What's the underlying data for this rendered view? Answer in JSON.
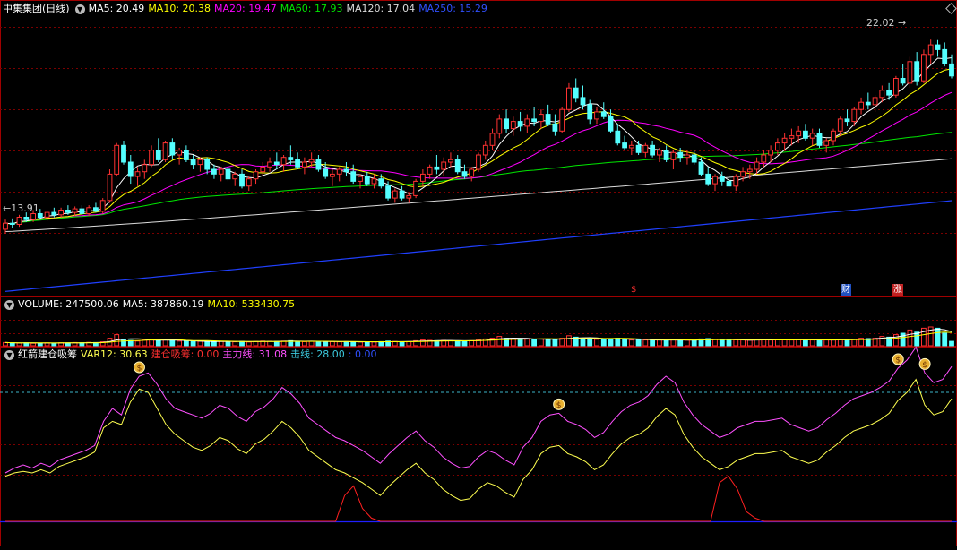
{
  "colors": {
    "up": "#ff3232",
    "down": "#54ffff",
    "ma5": "#ffffff",
    "ma10": "#ffff00",
    "ma20": "#ff00ff",
    "ma60": "#00e600",
    "ma120": "#dcdcdc",
    "ma250": "#2040ff",
    "grid": "#7a0000",
    "panel_border": "#a00000",
    "dashed_level": "#3cb4c8",
    "main_line": "#ff50ff",
    "var12_line": "#ffff50",
    "build_line": "#ff2020",
    "strike_line": "#2020ff"
  },
  "price_panel": {
    "title": "中集集团(日线)",
    "ma_labels": [
      {
        "text": "MA5: 20.49",
        "color": "#ffffff"
      },
      {
        "text": "MA10: 20.38",
        "color": "#ffff00"
      },
      {
        "text": "MA20: 19.47",
        "color": "#ff00ff"
      },
      {
        "text": "MA60: 17.93",
        "color": "#00e600"
      },
      {
        "text": "MA120: 17.04",
        "color": "#dcdcdc"
      },
      {
        "text": "MA250: 15.29",
        "color": "#3050ff"
      }
    ],
    "high_label": "22.02",
    "low_label": "13.91",
    "event_flags": [
      {
        "text": "$",
        "color": "#ff3030",
        "bg": "transparent"
      },
      {
        "text": "财",
        "color": "#ffffff",
        "bg": "#2050c0"
      },
      {
        "text": "涨",
        "color": "#ffffff",
        "bg": "#c02020"
      }
    ]
  },
  "volume_panel": {
    "labels": [
      {
        "text": "VOLUME: 247500.06",
        "color": "#ffffff"
      },
      {
        "text": "MA5: 387860.19",
        "color": "#ffffff"
      },
      {
        "text": "MA10: 533430.75",
        "color": "#ffff00"
      }
    ]
  },
  "indicator_panel": {
    "labels": [
      {
        "text": "红箭建仓吸筹",
        "color": "#ffffff"
      },
      {
        "text": "VAR12: 30.63",
        "color": "#ffff50"
      },
      {
        "text": "建仓吸筹: 0.00",
        "color": "#ff3030"
      },
      {
        "text": "主力线: 31.08",
        "color": "#ff50ff"
      },
      {
        "text": "击线: 28.00",
        "color": "#3cc8dc"
      },
      {
        "text": ": 0.00",
        "color": "#3050ff"
      }
    ],
    "money_icon_glyph": "$"
  },
  "chart_data": {
    "type": "candlestick",
    "title": "中集集团(日线)",
    "price_range": [
      11.4,
      23.0
    ],
    "candles_ohlc": [
      [
        14.1,
        14.5,
        13.91,
        14.35
      ],
      [
        14.35,
        14.55,
        14.15,
        14.3
      ],
      [
        14.3,
        14.7,
        14.2,
        14.6
      ],
      [
        14.6,
        14.8,
        14.4,
        14.5
      ],
      [
        14.5,
        14.9,
        14.4,
        14.75
      ],
      [
        14.75,
        14.95,
        14.55,
        14.6
      ],
      [
        14.6,
        14.85,
        14.45,
        14.8
      ],
      [
        14.8,
        15.0,
        14.6,
        14.7
      ],
      [
        14.7,
        15.0,
        14.6,
        14.9
      ],
      [
        14.9,
        15.1,
        14.7,
        14.8
      ],
      [
        14.8,
        15.05,
        14.65,
        14.95
      ],
      [
        14.95,
        15.1,
        14.7,
        14.75
      ],
      [
        14.75,
        15.1,
        14.65,
        15.0
      ],
      [
        15.0,
        15.2,
        14.8,
        14.85
      ],
      [
        14.85,
        15.4,
        14.75,
        15.3
      ],
      [
        15.3,
        16.6,
        15.2,
        16.4
      ],
      [
        16.4,
        17.7,
        16.3,
        17.6
      ],
      [
        17.6,
        17.8,
        16.8,
        16.9
      ],
      [
        16.9,
        17.2,
        16.0,
        16.3
      ],
      [
        16.3,
        16.7,
        15.9,
        16.5
      ],
      [
        16.5,
        17.0,
        16.2,
        16.8
      ],
      [
        16.8,
        17.6,
        16.7,
        17.4
      ],
      [
        17.4,
        17.9,
        16.9,
        17.0
      ],
      [
        17.0,
        17.8,
        16.9,
        17.7
      ],
      [
        17.7,
        17.9,
        17.0,
        17.2
      ],
      [
        17.2,
        17.5,
        16.8,
        17.4
      ],
      [
        17.4,
        17.6,
        16.9,
        17.0
      ],
      [
        17.0,
        17.2,
        16.6,
        16.8
      ],
      [
        16.8,
        17.1,
        16.5,
        17.0
      ],
      [
        17.0,
        17.1,
        16.4,
        16.6
      ],
      [
        16.6,
        16.8,
        16.2,
        16.4
      ],
      [
        16.4,
        16.7,
        16.1,
        16.6
      ],
      [
        16.6,
        16.8,
        16.1,
        16.2
      ],
      [
        16.2,
        16.5,
        15.9,
        16.4
      ],
      [
        16.4,
        16.6,
        15.8,
        15.9
      ],
      [
        15.9,
        16.3,
        15.7,
        16.2
      ],
      [
        16.2,
        16.6,
        16.0,
        16.5
      ],
      [
        16.5,
        16.9,
        16.3,
        16.7
      ],
      [
        16.7,
        17.1,
        16.5,
        16.9
      ],
      [
        16.9,
        17.3,
        16.6,
        16.8
      ],
      [
        16.8,
        17.2,
        16.5,
        17.1
      ],
      [
        17.1,
        17.6,
        16.8,
        17.0
      ],
      [
        17.0,
        17.3,
        16.6,
        16.7
      ],
      [
        16.7,
        17.1,
        16.4,
        16.9
      ],
      [
        16.9,
        17.3,
        16.7,
        17.0
      ],
      [
        17.0,
        17.2,
        16.5,
        16.6
      ],
      [
        16.6,
        16.9,
        16.2,
        16.3
      ],
      [
        16.3,
        16.6,
        15.9,
        16.4
      ],
      [
        16.4,
        16.7,
        16.1,
        16.6
      ],
      [
        16.6,
        16.9,
        16.3,
        16.5
      ],
      [
        16.5,
        16.8,
        16.0,
        16.1
      ],
      [
        16.1,
        16.4,
        15.8,
        16.3
      ],
      [
        16.3,
        16.5,
        15.9,
        16.0
      ],
      [
        16.0,
        16.4,
        15.8,
        16.2
      ],
      [
        16.2,
        16.4,
        15.8,
        15.9
      ],
      [
        15.9,
        16.1,
        15.3,
        15.4
      ],
      [
        15.4,
        15.8,
        15.2,
        15.7
      ],
      [
        15.7,
        15.9,
        15.3,
        15.4
      ],
      [
        15.4,
        15.6,
        15.2,
        15.5
      ],
      [
        15.5,
        16.2,
        15.4,
        16.1
      ],
      [
        16.1,
        16.6,
        15.9,
        16.4
      ],
      [
        16.4,
        16.8,
        16.2,
        16.7
      ],
      [
        16.7,
        17.2,
        16.4,
        16.6
      ],
      [
        16.6,
        17.1,
        16.3,
        16.9
      ],
      [
        16.9,
        17.3,
        16.7,
        17.0
      ],
      [
        17.0,
        17.2,
        16.4,
        16.5
      ],
      [
        16.5,
        16.8,
        16.2,
        16.3
      ],
      [
        16.3,
        16.7,
        16.1,
        16.6
      ],
      [
        16.6,
        17.3,
        16.5,
        17.2
      ],
      [
        17.2,
        17.8,
        17.0,
        17.6
      ],
      [
        17.6,
        18.3,
        17.4,
        18.1
      ],
      [
        18.1,
        18.9,
        17.9,
        18.7
      ],
      [
        18.7,
        19.1,
        18.1,
        18.3
      ],
      [
        18.3,
        18.8,
        18.0,
        18.6
      ],
      [
        18.6,
        19.0,
        18.2,
        18.4
      ],
      [
        18.4,
        18.9,
        18.1,
        18.7
      ],
      [
        18.7,
        19.2,
        18.4,
        18.6
      ],
      [
        18.6,
        19.1,
        18.3,
        18.9
      ],
      [
        18.9,
        19.3,
        18.4,
        18.5
      ],
      [
        18.5,
        18.9,
        18.0,
        18.2
      ],
      [
        18.2,
        19.2,
        18.1,
        19.1
      ],
      [
        19.1,
        20.2,
        19.0,
        20.0
      ],
      [
        20.0,
        20.4,
        19.4,
        19.6
      ],
      [
        19.6,
        20.1,
        19.1,
        19.3
      ],
      [
        19.3,
        19.5,
        18.5,
        18.7
      ],
      [
        18.7,
        19.2,
        18.5,
        19.0
      ],
      [
        19.0,
        19.4,
        18.7,
        18.8
      ],
      [
        18.8,
        19.1,
        18.1,
        18.2
      ],
      [
        18.2,
        18.5,
        17.6,
        17.7
      ],
      [
        17.7,
        18.0,
        17.4,
        17.5
      ],
      [
        17.5,
        17.8,
        17.2,
        17.6
      ],
      [
        17.6,
        17.8,
        17.2,
        17.3
      ],
      [
        17.3,
        17.7,
        17.1,
        17.6
      ],
      [
        17.6,
        17.8,
        17.1,
        17.2
      ],
      [
        17.2,
        17.5,
        16.9,
        17.4
      ],
      [
        17.4,
        17.6,
        16.9,
        17.0
      ],
      [
        17.0,
        17.4,
        16.6,
        17.3
      ],
      [
        17.3,
        17.5,
        16.9,
        17.1
      ],
      [
        17.1,
        17.4,
        16.8,
        17.2
      ],
      [
        17.2,
        17.4,
        16.8,
        16.9
      ],
      [
        16.9,
        17.1,
        16.3,
        16.4
      ],
      [
        16.4,
        16.7,
        15.9,
        16.0
      ],
      [
        16.0,
        16.4,
        15.7,
        16.3
      ],
      [
        16.3,
        16.5,
        15.9,
        16.1
      ],
      [
        16.1,
        16.4,
        15.8,
        15.9
      ],
      [
        15.9,
        16.4,
        15.7,
        16.3
      ],
      [
        16.3,
        16.7,
        16.1,
        16.5
      ],
      [
        16.5,
        16.8,
        16.2,
        16.6
      ],
      [
        16.6,
        17.1,
        16.4,
        16.9
      ],
      [
        16.9,
        17.4,
        16.7,
        17.2
      ],
      [
        17.2,
        17.6,
        16.9,
        17.4
      ],
      [
        17.4,
        17.9,
        17.2,
        17.7
      ],
      [
        17.7,
        18.1,
        17.4,
        17.9
      ],
      [
        17.9,
        18.3,
        17.6,
        18.0
      ],
      [
        18.0,
        18.4,
        17.7,
        18.2
      ],
      [
        18.2,
        18.5,
        17.8,
        17.9
      ],
      [
        17.9,
        18.3,
        17.6,
        18.1
      ],
      [
        18.1,
        18.3,
        17.5,
        17.6
      ],
      [
        17.6,
        17.9,
        17.3,
        17.8
      ],
      [
        17.8,
        18.3,
        17.6,
        18.2
      ],
      [
        18.2,
        18.8,
        18.0,
        18.7
      ],
      [
        18.7,
        19.1,
        18.4,
        18.6
      ],
      [
        18.6,
        19.2,
        18.4,
        19.1
      ],
      [
        19.1,
        19.6,
        18.9,
        19.4
      ],
      [
        19.4,
        19.8,
        19.1,
        19.3
      ],
      [
        19.3,
        19.7,
        19.0,
        19.6
      ],
      [
        19.6,
        20.1,
        19.4,
        19.9
      ],
      [
        19.9,
        20.2,
        19.5,
        19.7
      ],
      [
        19.7,
        20.5,
        19.6,
        20.4
      ],
      [
        20.4,
        21.0,
        20.1,
        20.2
      ],
      [
        20.2,
        21.3,
        20.0,
        21.1
      ],
      [
        21.1,
        21.5,
        20.1,
        20.3
      ],
      [
        20.3,
        21.6,
        20.2,
        21.4
      ],
      [
        21.4,
        22.02,
        21.0,
        21.8
      ],
      [
        21.8,
        22.0,
        21.3,
        21.6
      ],
      [
        21.6,
        21.9,
        20.9,
        21.0
      ],
      [
        21.0,
        21.4,
        20.4,
        20.5
      ]
    ],
    "volume_range": [
      0,
      1900000
    ],
    "volumes": [
      180000,
      160000,
      150000,
      170000,
      140000,
      150000,
      160000,
      150000,
      170000,
      160000,
      180000,
      170000,
      190000,
      180000,
      220000,
      420000,
      620000,
      360000,
      300000,
      260000,
      320000,
      360000,
      300000,
      340000,
      280000,
      260000,
      250000,
      240000,
      250000,
      230000,
      240000,
      250000,
      230000,
      220000,
      240000,
      210000,
      240000,
      260000,
      250000,
      240000,
      260000,
      280000,
      250000,
      230000,
      250000,
      240000,
      220000,
      230000,
      220000,
      230000,
      220000,
      210000,
      220000,
      210000,
      230000,
      260000,
      240000,
      220000,
      230000,
      280000,
      320000,
      300000,
      280000,
      300000,
      280000,
      270000,
      260000,
      280000,
      340000,
      380000,
      420000,
      520000,
      420000,
      380000,
      360000,
      370000,
      350000,
      380000,
      360000,
      340000,
      420000,
      560000,
      480000,
      420000,
      380000,
      360000,
      350000,
      380000,
      420000,
      350000,
      320000,
      330000,
      320000,
      310000,
      330000,
      300000,
      340000,
      320000,
      310000,
      300000,
      380000,
      400000,
      360000,
      320000,
      300000,
      330000,
      320000,
      310000,
      340000,
      330000,
      320000,
      340000,
      330000,
      320000,
      340000,
      330000,
      320000,
      310000,
      320000,
      330000,
      360000,
      350000,
      370000,
      420000,
      400000,
      420000,
      520000,
      480000,
      620000,
      700000,
      880000,
      760000,
      980000,
      1050000,
      980000,
      700000,
      247500
    ],
    "indicator_range": [
      0,
      100
    ],
    "dashed_level": 80,
    "main_force_line": [
      30,
      33,
      35,
      33,
      36,
      34,
      38,
      40,
      42,
      44,
      47,
      62,
      70,
      66,
      82,
      90,
      92,
      85,
      76,
      70,
      68,
      66,
      64,
      67,
      72,
      70,
      65,
      62,
      68,
      71,
      76,
      83,
      79,
      73,
      64,
      60,
      56,
      52,
      50,
      47,
      44,
      40,
      36,
      42,
      47,
      52,
      56,
      50,
      46,
      40,
      36,
      33,
      34,
      40,
      44,
      42,
      38,
      35,
      46,
      52,
      62,
      66,
      67,
      62,
      60,
      57,
      52,
      55,
      62,
      68,
      72,
      74,
      78,
      85,
      90,
      86,
      74,
      66,
      60,
      56,
      52,
      54,
      58,
      60,
      62,
      62,
      63,
      64,
      60,
      58,
      56,
      58,
      63,
      67,
      72,
      76,
      78,
      80,
      83,
      87,
      95,
      100,
      108,
      92,
      86,
      88,
      96
    ],
    "var12_line": [
      28,
      30,
      31,
      30,
      32,
      30,
      34,
      36,
      38,
      40,
      43,
      58,
      62,
      60,
      74,
      82,
      80,
      70,
      60,
      54,
      50,
      46,
      44,
      47,
      52,
      50,
      45,
      42,
      48,
      51,
      56,
      62,
      58,
      52,
      44,
      40,
      36,
      32,
      30,
      27,
      24,
      20,
      16,
      22,
      27,
      32,
      36,
      30,
      26,
      20,
      16,
      13,
      14,
      20,
      24,
      22,
      18,
      15,
      26,
      32,
      42,
      46,
      47,
      42,
      40,
      37,
      32,
      35,
      42,
      48,
      52,
      54,
      58,
      65,
      70,
      66,
      54,
      46,
      40,
      36,
      32,
      34,
      38,
      40,
      42,
      42,
      43,
      44,
      40,
      38,
      36,
      38,
      43,
      47,
      52,
      56,
      58,
      60,
      63,
      67,
      75,
      80,
      88,
      72,
      66,
      68,
      76
    ],
    "build_position_line": [
      0,
      0,
      0,
      0,
      0,
      0,
      0,
      0,
      0,
      0,
      0,
      0,
      0,
      0,
      0,
      0,
      0,
      0,
      0,
      0,
      0,
      0,
      0,
      0,
      0,
      0,
      0,
      0,
      0,
      0,
      0,
      0,
      0,
      0,
      0,
      0,
      0,
      0,
      16,
      22,
      8,
      2,
      0,
      0,
      0,
      0,
      0,
      0,
      0,
      0,
      0,
      0,
      0,
      0,
      0,
      0,
      0,
      0,
      0,
      0,
      0,
      0,
      0,
      0,
      0,
      0,
      0,
      0,
      0,
      0,
      0,
      0,
      0,
      0,
      0,
      0,
      0,
      0,
      0,
      0,
      24,
      28,
      20,
      6,
      2,
      0,
      0,
      0,
      0,
      0,
      0,
      0,
      0,
      0,
      0,
      0,
      0,
      0,
      0,
      0,
      0,
      0,
      0,
      0,
      0,
      0,
      0
    ],
    "money_icons_at_main_index": [
      15,
      62,
      100,
      103
    ]
  }
}
